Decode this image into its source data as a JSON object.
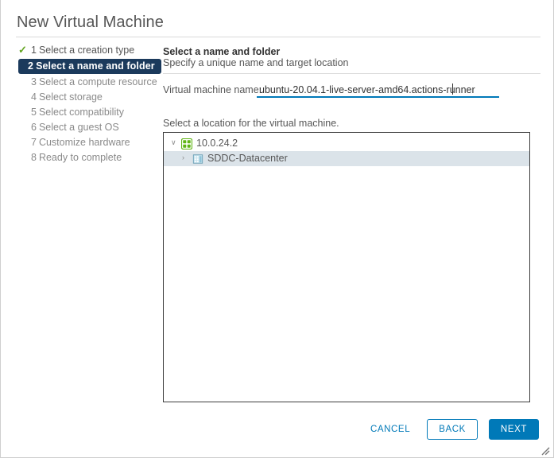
{
  "window": {
    "title": "New Virtual Machine",
    "resize_grip_icon": "resize-grip-icon"
  },
  "steps": [
    {
      "num": "1",
      "label": "Select a creation type",
      "state": "done",
      "check_icon": "check-icon"
    },
    {
      "num": "2",
      "label": "Select a name and folder",
      "state": "active"
    },
    {
      "num": "3",
      "label": "Select a compute resource",
      "state": "pending"
    },
    {
      "num": "4",
      "label": "Select storage",
      "state": "pending"
    },
    {
      "num": "5",
      "label": "Select compatibility",
      "state": "pending"
    },
    {
      "num": "6",
      "label": "Select a guest OS",
      "state": "pending"
    },
    {
      "num": "7",
      "label": "Customize hardware",
      "state": "pending"
    },
    {
      "num": "8",
      "label": "Ready to complete",
      "state": "pending"
    }
  ],
  "panel": {
    "heading": "Select a name and folder",
    "subheading": "Specify a unique name and target location",
    "name_field": {
      "label": "Virtual machine name:",
      "value": "ubuntu-20.04.1-live-server-amd64.actions-runner",
      "placeholder": ""
    },
    "location_label": "Select a location for the virtual machine.",
    "tree": [
      {
        "label": "10.0.24.2",
        "level": 0,
        "expanded": true,
        "twisty": "∨",
        "icon": "vcenter-icon",
        "selected": false
      },
      {
        "label": "SDDC-Datacenter",
        "level": 1,
        "expanded": false,
        "twisty": "›",
        "icon": "datacenter-icon",
        "selected": true
      }
    ]
  },
  "footer": {
    "cancel_label": "CANCEL",
    "back_label": "BACK",
    "next_label": "NEXT"
  },
  "colors": {
    "accent": "#0079b8",
    "active_step_bg": "#1b3a5c",
    "check_green": "#62a420",
    "tree_selected_bg": "#dbe3e9",
    "vcenter_green": "#60b515",
    "datacenter_blue": "#89cbdf"
  }
}
